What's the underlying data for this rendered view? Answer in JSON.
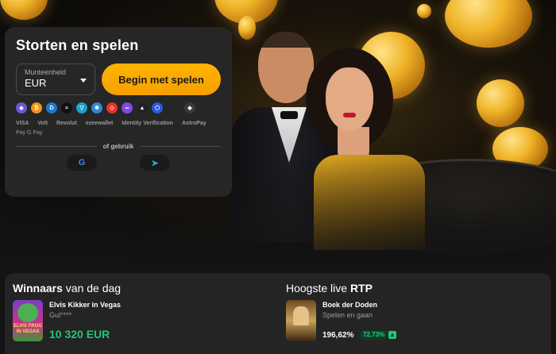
{
  "deposit": {
    "title": "Storten en spelen",
    "currency_label": "Munteenheid",
    "currency_value": "EUR",
    "cta_label": "Begin met spelen",
    "crypto_icons": [
      {
        "name": "ethereum-icon",
        "glyph": "◆",
        "color": "#6f55d6"
      },
      {
        "name": "bitcoin-icon",
        "glyph": "₿",
        "color": "#f2931a"
      },
      {
        "name": "dash-icon",
        "glyph": "D",
        "color": "#1c78d3"
      },
      {
        "name": "stellar-icon",
        "glyph": "≈",
        "color": "#111111"
      },
      {
        "name": "tron-icon",
        "glyph": "▽",
        "color": "#1ba0c9"
      },
      {
        "name": "ripple-icon",
        "glyph": "✱",
        "color": "#2a8ad8"
      },
      {
        "name": "bnb-icon",
        "glyph": "◇",
        "color": "#e8312b"
      },
      {
        "name": "polygon-icon",
        "glyph": "∞",
        "color": "#8247e5"
      },
      {
        "name": "ethereum-classic-icon",
        "glyph": "▲",
        "color": "#222222"
      },
      {
        "name": "chainlink-icon",
        "glyph": "⬡",
        "color": "#2a5ada"
      },
      {
        "name": "binance-coin-icon",
        "glyph": "◆",
        "color": "#3a3a3a"
      }
    ],
    "payment_methods": [
      "VISA",
      "Volt",
      "Revolut",
      "ezeewallet",
      "Identity Verification",
      "AstroPay"
    ],
    "wallets": "Pay G Pay",
    "divider_text": "of gebruik",
    "social": [
      {
        "name": "google-icon",
        "glyph": "G"
      },
      {
        "name": "telegram-icon",
        "glyph": "➤"
      }
    ]
  },
  "winners": {
    "title_bold": "Winnaars",
    "title_rest": "van de dag",
    "game": "Elvis Kikker in Vegas",
    "user": "Gul****",
    "amount": "10 320 EUR"
  },
  "rtp": {
    "title_rest": "Hoogste live",
    "title_bold": "RTP",
    "game": "Boek der Doden",
    "provider": "Spelen en gaan",
    "value": "196,62%",
    "change": "72,73%"
  }
}
